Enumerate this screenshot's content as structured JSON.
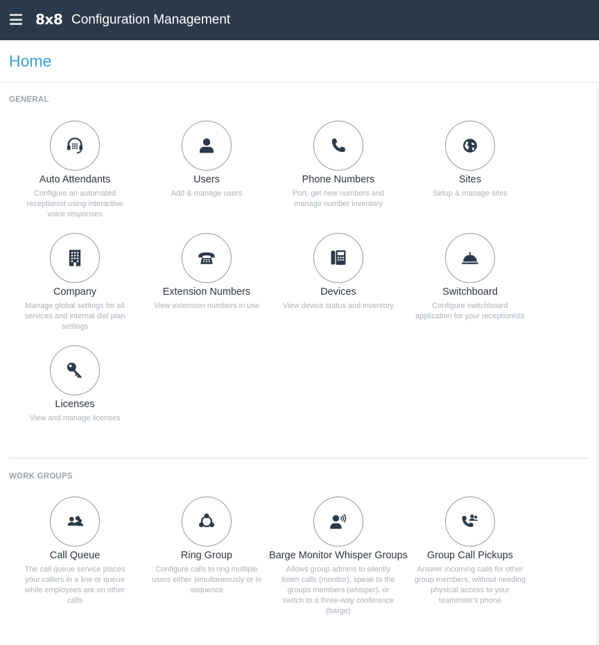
{
  "header": {
    "logo": "8x8",
    "app_title": "Configuration Management"
  },
  "page": {
    "title": "Home"
  },
  "sections": {
    "general": {
      "label": "GENERAL",
      "tiles": [
        {
          "name": "Auto Attendants",
          "desc": "Configure an automated receptionist using interactive voice responses",
          "icon": "headset-icon"
        },
        {
          "name": "Users",
          "desc": "Add & manage users",
          "icon": "user-icon"
        },
        {
          "name": "Phone Numbers",
          "desc": "Port, get new numbers and manage number inventory",
          "icon": "phone-icon"
        },
        {
          "name": "Sites",
          "desc": "Setup & manage sites",
          "icon": "globe-icon"
        },
        {
          "name": "Company",
          "desc": "Manage global settings for all services and internal dial plan settings",
          "icon": "building-icon"
        },
        {
          "name": "Extension Numbers",
          "desc": "View extension numbers in use",
          "icon": "desk-phone-icon"
        },
        {
          "name": "Devices",
          "desc": "View device status and inventory",
          "icon": "device-icon"
        },
        {
          "name": "Switchboard",
          "desc": "Configure switchboard application for your receptionists",
          "icon": "service-bell-icon"
        },
        {
          "name": "Licenses",
          "desc": "View and manage licenses",
          "icon": "key-icon"
        }
      ]
    },
    "work_groups": {
      "label": "WORK GROUPS",
      "tiles": [
        {
          "name": "Call Queue",
          "desc": "The call queue service places your callers in a line or queue while employees are on other calls",
          "icon": "queue-users-icon"
        },
        {
          "name": "Ring Group",
          "desc": "Configure calls to ring multiple users either simultaneously or in sequence",
          "icon": "ring-group-icon"
        },
        {
          "name": "Barge Monitor Whisper Groups",
          "desc": "Allows group admins to silently listen calls (monitor), speak to the groups members (whisper), or switch to a three-way conference (barge)",
          "icon": "whisper-icon"
        },
        {
          "name": "Group Call Pickups",
          "desc": "Answer incoming calls for other group members, without needing physical access to your teammate's phone",
          "icon": "call-pickup-icon"
        }
      ]
    }
  },
  "colors": {
    "topbar": "#2b3a4a",
    "title_blue": "#3aa0d8",
    "icon_dark": "#2b3a4a"
  }
}
